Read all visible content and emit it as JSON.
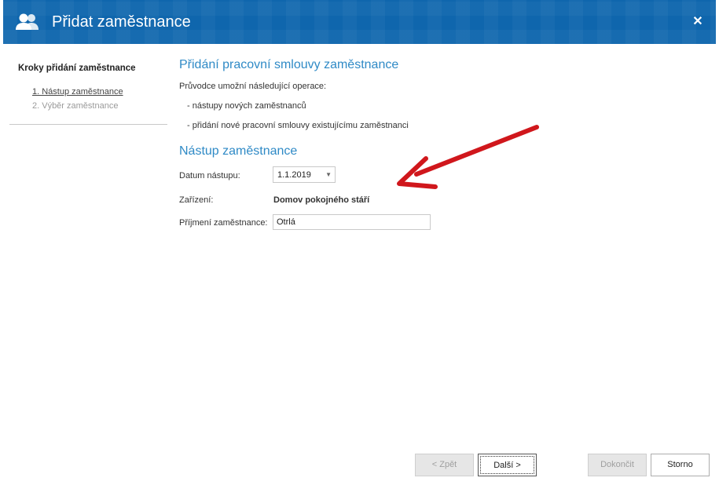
{
  "window": {
    "title": "Přidat zaměstnance",
    "close_glyph": "✕",
    "title_icon": "users-icon",
    "accent_color": "#0f66ad"
  },
  "sidebar": {
    "heading": "Kroky přidání zaměstnance",
    "steps": [
      {
        "label": "1. Nástup zaměstnance",
        "active": true
      },
      {
        "label": "2. Výběr zaměstnance",
        "active": false
      }
    ]
  },
  "main": {
    "section1_title": "Přidání pracovní smlouvy zaměstnance",
    "intro": "Průvodce umožní následující operace:",
    "bullets": [
      "- nástupy nových zaměstnanců",
      "- přidání nové pracovní smlouvy existujícímu zaměstnanci"
    ],
    "section2_title": "Nástup zaměstnance",
    "form": {
      "date_label": "Datum nástupu:",
      "date_value": "1.1.2019",
      "facility_label": "Zařízení:",
      "facility_value": "Domov pokojného stáří",
      "surname_label": "Příjmení zaměstnance:",
      "surname_value": "Otrlá"
    },
    "annotation_arrow_color": "#d0171c"
  },
  "footer": {
    "back_label": "< Zpět",
    "next_label": "Další >",
    "finish_label": "Dokončit",
    "cancel_label": "Storno"
  }
}
